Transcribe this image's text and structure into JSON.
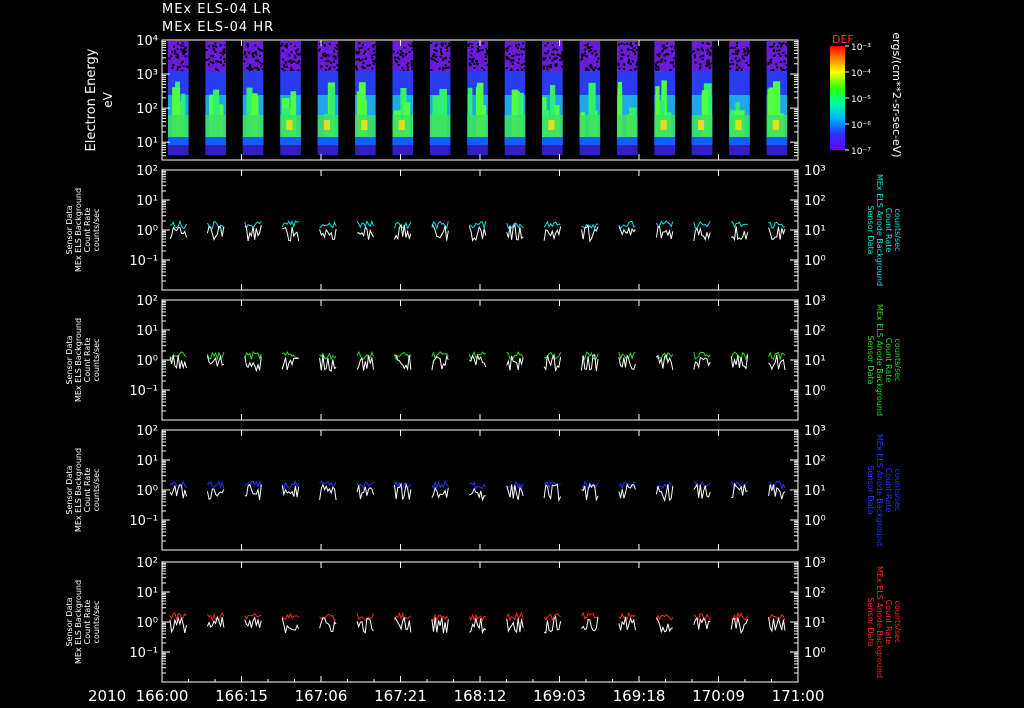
{
  "header": {
    "line1": "MEx ELS-04 LR",
    "line2": "MEx ELS-04 HR"
  },
  "colorbar": {
    "title": "DEF",
    "ticks": [
      "10⁻³",
      "10⁻⁴",
      "10⁻⁵",
      "10⁻⁶",
      "10⁻⁷"
    ],
    "units": "ergs/(cm**2-sr-sec-eV)"
  },
  "xaxis": {
    "year": "2010",
    "ticks": [
      "166:00",
      "166:15",
      "167:06",
      "167:21",
      "168:12",
      "169:03",
      "169:18",
      "170:09",
      "171:00"
    ]
  },
  "chart_data": [
    {
      "type": "heatmap",
      "title": "",
      "ylabel": "Electron Energy",
      "yunits": "eV",
      "yscale": "log",
      "ylim": [
        3,
        10000
      ],
      "yticks": [
        "10⁴",
        "10³",
        "10²",
        "10¹"
      ],
      "colorscale": "rainbow",
      "clim": [
        1e-07,
        0.001
      ],
      "segments": 17,
      "note_values": "orbit-segment spectrogram, peak intensity ~10 to 100 eV"
    },
    {
      "type": "line",
      "yscale": "log",
      "ylim": [
        0.01,
        100
      ],
      "yticks": [
        "10²",
        "10¹",
        "10⁰",
        "10⁻¹"
      ],
      "y2lim": [
        0.1,
        1000
      ],
      "y2ticks": [
        "10³",
        "10²",
        "10¹",
        "10⁰"
      ],
      "ylabel_lines": [
        "Sensor Data",
        "MEx ELS Background",
        "Count Rate",
        "counts/sec"
      ],
      "y2label_lines": [
        "Sensor Data",
        "MEx ELS Anode Background",
        "Count Rate",
        "counts/sec"
      ],
      "series": [
        {
          "color": "#00e5e5",
          "level": 1.5
        },
        {
          "color": "#ffffff",
          "level": 0.8
        }
      ]
    },
    {
      "type": "line",
      "yscale": "log",
      "ylim": [
        0.01,
        100
      ],
      "yticks": [
        "10²",
        "10¹",
        "10⁰",
        "10⁻¹"
      ],
      "y2lim": [
        0.1,
        1000
      ],
      "y2ticks": [
        "10³",
        "10²",
        "10¹",
        "10⁰"
      ],
      "ylabel_lines": [
        "Sensor Data",
        "MEx ELS Background",
        "Count Rate",
        "counts/sec"
      ],
      "y2label_lines": [
        "Sensor Data",
        "MEx ELS Anode Background",
        "Count Rate",
        "counts/sec"
      ],
      "series": [
        {
          "color": "#22dd22",
          "level": 1.4
        },
        {
          "color": "#ffffff",
          "level": 0.8
        }
      ]
    },
    {
      "type": "line",
      "yscale": "log",
      "ylim": [
        0.01,
        100
      ],
      "yticks": [
        "10²",
        "10¹",
        "10⁰",
        "10⁻¹"
      ],
      "y2lim": [
        0.1,
        1000
      ],
      "y2ticks": [
        "10³",
        "10²",
        "10¹",
        "10⁰"
      ],
      "ylabel_lines": [
        "Sensor Data",
        "MEx ELS Background",
        "Count Rate",
        "counts/sec"
      ],
      "y2label_lines": [
        "Sensor Data",
        "MEx ELS Anode Background",
        "Count Rate",
        "counts/sec"
      ],
      "series": [
        {
          "color": "#2233ff",
          "level": 1.45
        },
        {
          "color": "#ffffff",
          "level": 0.85
        }
      ]
    },
    {
      "type": "line",
      "yscale": "log",
      "ylim": [
        0.01,
        100
      ],
      "yticks": [
        "10²",
        "10¹",
        "10⁰",
        "10⁻¹"
      ],
      "y2lim": [
        0.1,
        1000
      ],
      "y2ticks": [
        "10³",
        "10²",
        "10¹",
        "10⁰"
      ],
      "ylabel_lines": [
        "Sensor Data",
        "MEx ELS Background",
        "Count Rate",
        "counts/sec"
      ],
      "y2label_lines": [
        "Sensor Data",
        "MEx ELS Anode Background",
        "Count Rate",
        "counts/sec"
      ],
      "series": [
        {
          "color": "#ff2222",
          "level": 1.5
        },
        {
          "color": "#ffffff",
          "level": 0.8
        }
      ]
    }
  ]
}
